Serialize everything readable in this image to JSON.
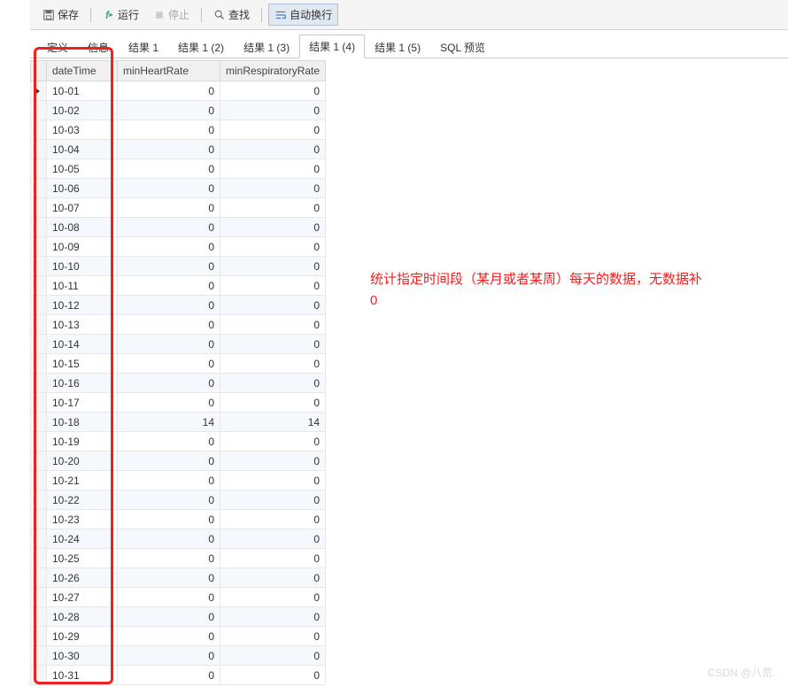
{
  "toolbar": {
    "save": "保存",
    "run": "运行",
    "stop": "停止",
    "find": "查找",
    "wrap": "自动换行"
  },
  "tabs": [
    {
      "label": "定义",
      "active": false
    },
    {
      "label": "信息",
      "active": false
    },
    {
      "label": "结果 1",
      "active": false
    },
    {
      "label": "结果 1 (2)",
      "active": false
    },
    {
      "label": "结果 1 (3)",
      "active": false
    },
    {
      "label": "结果 1 (4)",
      "active": true
    },
    {
      "label": "结果 1 (5)",
      "active": false
    },
    {
      "label": "SQL 预览",
      "active": false
    }
  ],
  "columns": [
    "dateTime",
    "minHeartRate",
    "minRespiratoryRate"
  ],
  "rows": [
    {
      "dateTime": "10-01",
      "minHeartRate": 0,
      "minRespiratoryRate": 0
    },
    {
      "dateTime": "10-02",
      "minHeartRate": 0,
      "minRespiratoryRate": 0
    },
    {
      "dateTime": "10-03",
      "minHeartRate": 0,
      "minRespiratoryRate": 0
    },
    {
      "dateTime": "10-04",
      "minHeartRate": 0,
      "minRespiratoryRate": 0
    },
    {
      "dateTime": "10-05",
      "minHeartRate": 0,
      "minRespiratoryRate": 0
    },
    {
      "dateTime": "10-06",
      "minHeartRate": 0,
      "minRespiratoryRate": 0
    },
    {
      "dateTime": "10-07",
      "minHeartRate": 0,
      "minRespiratoryRate": 0
    },
    {
      "dateTime": "10-08",
      "minHeartRate": 0,
      "minRespiratoryRate": 0
    },
    {
      "dateTime": "10-09",
      "minHeartRate": 0,
      "minRespiratoryRate": 0
    },
    {
      "dateTime": "10-10",
      "minHeartRate": 0,
      "minRespiratoryRate": 0
    },
    {
      "dateTime": "10-11",
      "minHeartRate": 0,
      "minRespiratoryRate": 0
    },
    {
      "dateTime": "10-12",
      "minHeartRate": 0,
      "minRespiratoryRate": 0
    },
    {
      "dateTime": "10-13",
      "minHeartRate": 0,
      "minRespiratoryRate": 0
    },
    {
      "dateTime": "10-14",
      "minHeartRate": 0,
      "minRespiratoryRate": 0
    },
    {
      "dateTime": "10-15",
      "minHeartRate": 0,
      "minRespiratoryRate": 0
    },
    {
      "dateTime": "10-16",
      "minHeartRate": 0,
      "minRespiratoryRate": 0
    },
    {
      "dateTime": "10-17",
      "minHeartRate": 0,
      "minRespiratoryRate": 0
    },
    {
      "dateTime": "10-18",
      "minHeartRate": 14,
      "minRespiratoryRate": 14
    },
    {
      "dateTime": "10-19",
      "minHeartRate": 0,
      "minRespiratoryRate": 0
    },
    {
      "dateTime": "10-20",
      "minHeartRate": 0,
      "minRespiratoryRate": 0
    },
    {
      "dateTime": "10-21",
      "minHeartRate": 0,
      "minRespiratoryRate": 0
    },
    {
      "dateTime": "10-22",
      "minHeartRate": 0,
      "minRespiratoryRate": 0
    },
    {
      "dateTime": "10-23",
      "minHeartRate": 0,
      "minRespiratoryRate": 0
    },
    {
      "dateTime": "10-24",
      "minHeartRate": 0,
      "minRespiratoryRate": 0
    },
    {
      "dateTime": "10-25",
      "minHeartRate": 0,
      "minRespiratoryRate": 0
    },
    {
      "dateTime": "10-26",
      "minHeartRate": 0,
      "minRespiratoryRate": 0
    },
    {
      "dateTime": "10-27",
      "minHeartRate": 0,
      "minRespiratoryRate": 0
    },
    {
      "dateTime": "10-28",
      "minHeartRate": 0,
      "minRespiratoryRate": 0
    },
    {
      "dateTime": "10-29",
      "minHeartRate": 0,
      "minRespiratoryRate": 0
    },
    {
      "dateTime": "10-30",
      "minHeartRate": 0,
      "minRespiratoryRate": 0
    },
    {
      "dateTime": "10-31",
      "minHeartRate": 0,
      "minRespiratoryRate": 0
    }
  ],
  "annotation": "统计指定时间段（某月或者某周）每天的数据，无数据补0",
  "watermark": "CSDN @八荒."
}
